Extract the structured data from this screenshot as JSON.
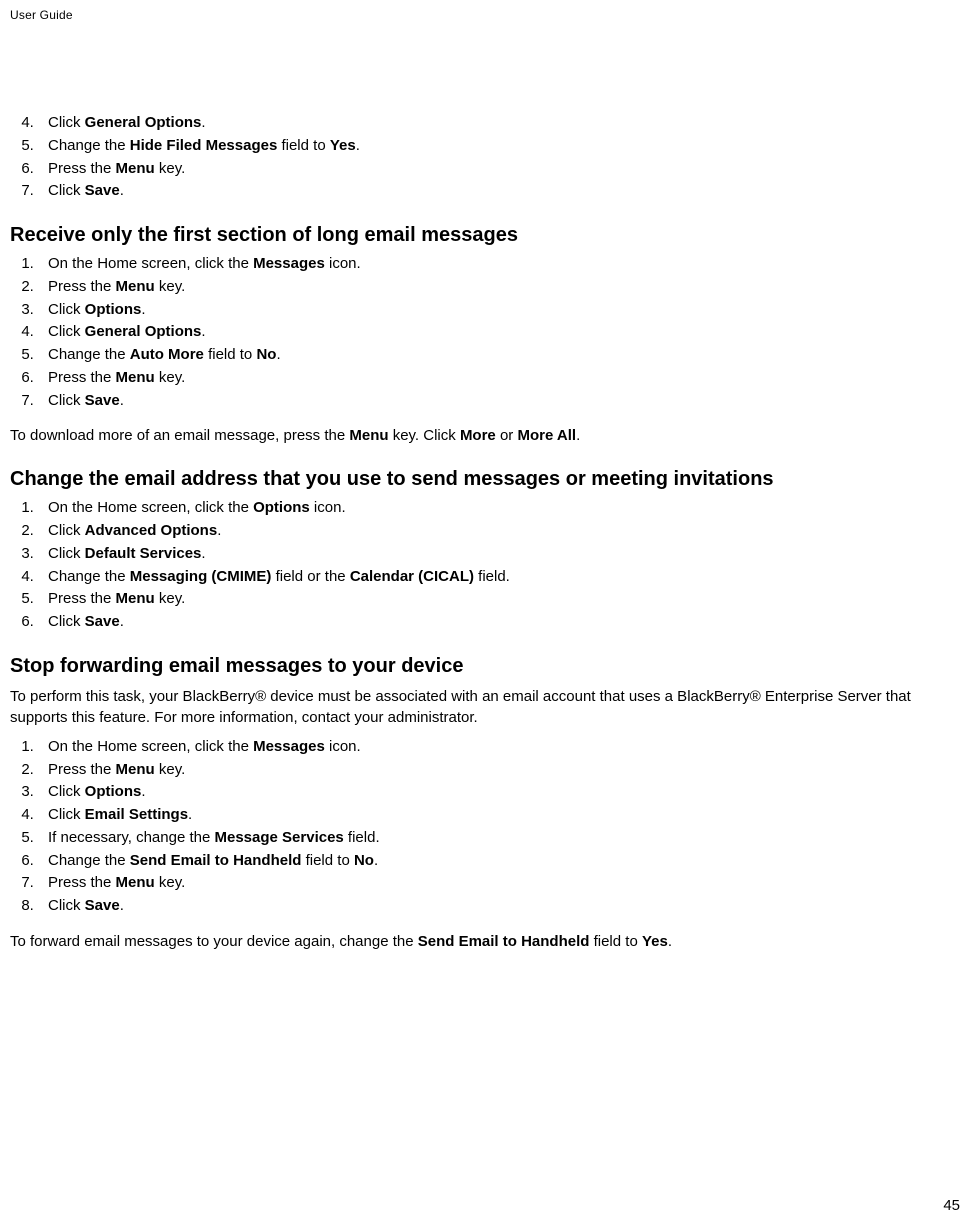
{
  "header": {
    "label": "User Guide"
  },
  "pageNumber": "45",
  "sectionA": {
    "start": 4,
    "steps": [
      {
        "pre": "Click ",
        "b1": "General Options",
        "post": "."
      },
      {
        "pre": "Change the ",
        "b1": "Hide Filed Messages",
        "mid": " field to ",
        "b2": "Yes",
        "post": "."
      },
      {
        "pre": "Press the ",
        "b1": "Menu",
        "post": " key."
      },
      {
        "pre": "Click ",
        "b1": "Save",
        "post": "."
      }
    ]
  },
  "sectionB": {
    "heading": "Receive only the first section of long email messages",
    "steps": [
      {
        "pre": "On the Home screen, click the ",
        "b1": "Messages",
        "post": " icon."
      },
      {
        "pre": "Press the ",
        "b1": "Menu",
        "post": " key."
      },
      {
        "pre": "Click ",
        "b1": "Options",
        "post": "."
      },
      {
        "pre": "Click ",
        "b1": "General Options",
        "post": "."
      },
      {
        "pre": "Change the ",
        "b1": "Auto More",
        "mid": " field to ",
        "b2": "No",
        "post": "."
      },
      {
        "pre": "Press the ",
        "b1": "Menu",
        "post": " key."
      },
      {
        "pre": "Click ",
        "b1": "Save",
        "post": "."
      }
    ],
    "tail": {
      "t1": "To download more of an email message, press the ",
      "b1": "Menu",
      "t2": " key. Click ",
      "b2": "More",
      "t3": " or ",
      "b3": "More All",
      "t4": "."
    }
  },
  "sectionC": {
    "heading": "Change the email address that you use to send messages or meeting invitations",
    "steps": [
      {
        "pre": "On the Home screen, click the ",
        "b1": "Options",
        "post": " icon."
      },
      {
        "pre": "Click ",
        "b1": "Advanced Options",
        "post": "."
      },
      {
        "pre": "Click ",
        "b1": "Default Services",
        "post": "."
      },
      {
        "pre": "Change the ",
        "b1": "Messaging (CMIME)",
        "mid": " field or the ",
        "b2": "Calendar (CICAL)",
        "post": " field."
      },
      {
        "pre": "Press the ",
        "b1": "Menu",
        "post": " key."
      },
      {
        "pre": "Click ",
        "b1": "Save",
        "post": "."
      }
    ]
  },
  "sectionD": {
    "heading": "Stop forwarding email messages to your device",
    "intro": "To perform this task, your BlackBerry® device must be associated with an email account that uses a BlackBerry® Enterprise Server that supports this feature. For more information, contact your administrator.",
    "steps": [
      {
        "pre": "On the Home screen, click the ",
        "b1": "Messages",
        "post": " icon."
      },
      {
        "pre": "Press the ",
        "b1": "Menu",
        "post": " key."
      },
      {
        "pre": "Click ",
        "b1": "Options",
        "post": "."
      },
      {
        "pre": "Click ",
        "b1": "Email Settings",
        "post": "."
      },
      {
        "pre": "If necessary, change the ",
        "b1": "Message Services",
        "post": " field."
      },
      {
        "pre": "Change the ",
        "b1": "Send Email to Handheld",
        "mid": " field to ",
        "b2": "No",
        "post": "."
      },
      {
        "pre": "Press the ",
        "b1": "Menu",
        "post": " key."
      },
      {
        "pre": "Click ",
        "b1": "Save",
        "post": "."
      }
    ],
    "tail": {
      "t1": "To forward email messages to your device again, change the ",
      "b1": "Send Email to Handheld",
      "t2": " field to ",
      "b2": "Yes",
      "t3": "."
    }
  }
}
